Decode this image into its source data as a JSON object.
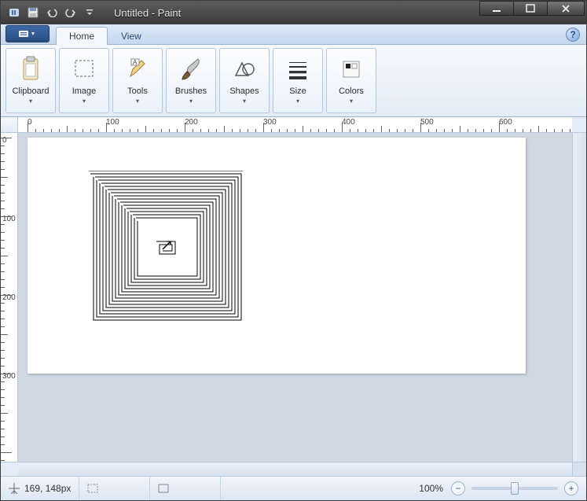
{
  "window": {
    "title": "Untitled - Paint"
  },
  "qat": {
    "save_icon": "save-icon",
    "undo_icon": "undo-icon",
    "redo_icon": "redo-icon"
  },
  "tabs": {
    "home": "Home",
    "view": "View"
  },
  "ribbon_groups": [
    {
      "key": "clipboard",
      "label": "Clipboard"
    },
    {
      "key": "image",
      "label": "Image"
    },
    {
      "key": "tools",
      "label": "Tools"
    },
    {
      "key": "brushes",
      "label": "Brushes"
    },
    {
      "key": "shapes",
      "label": "Shapes"
    },
    {
      "key": "size",
      "label": "Size"
    },
    {
      "key": "colors",
      "label": "Colors"
    }
  ],
  "ruler": {
    "h_labels": [
      "0",
      "100",
      "200",
      "300",
      "400",
      "500",
      "600"
    ],
    "v_labels": [
      "0",
      "100",
      "200",
      "300"
    ]
  },
  "status": {
    "cursor_pos": "169, 148px",
    "zoom_label": "100%"
  }
}
